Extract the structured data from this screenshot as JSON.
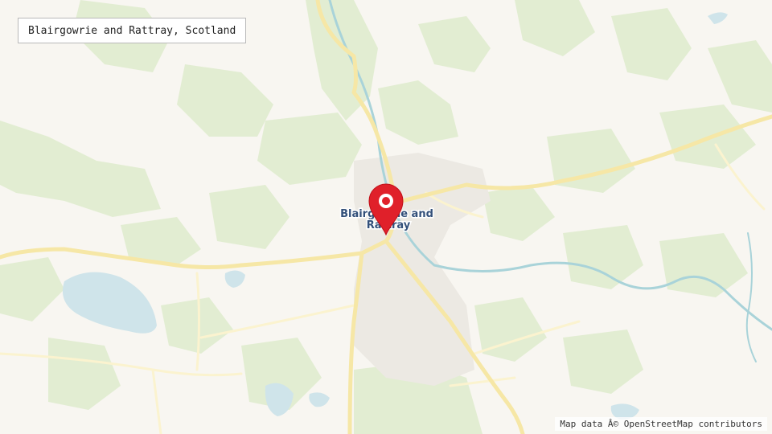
{
  "map": {
    "title": "Blairgowrie and Rattray, Scotland",
    "town_label": "Blairgowrie and Rattray",
    "attribution": "Map data Â© OpenStreetMap contributors",
    "marker_icon": "map-pin-icon",
    "colors": {
      "background": "#f8f6f1",
      "woodland": "#e2edd2",
      "water": "#cfe4ea",
      "river": "#a9d3d9",
      "major_road": "#f6e7a6",
      "minor_road": "#fbf3cf",
      "urban": "#ece9e3",
      "marker": "#e0202a"
    }
  }
}
